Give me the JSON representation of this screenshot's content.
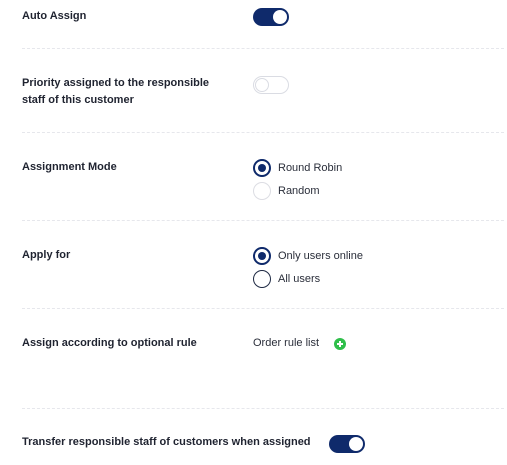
{
  "settings": {
    "auto_assign": {
      "label": "Auto Assign",
      "enabled": true
    },
    "priority_responsible": {
      "label_line1": "Priority assigned to the responsible",
      "label_line2": "staff of this customer",
      "enabled": false
    },
    "assignment_mode": {
      "label": "Assignment Mode",
      "options": [
        "Round Robin",
        "Random"
      ],
      "selected": "Round Robin"
    },
    "apply_for": {
      "label": "Apply for",
      "options": [
        "Only users online",
        "All users"
      ],
      "selected": "Only users online"
    },
    "optional_rule": {
      "label": "Assign according to optional rule",
      "link_text": "Order rule list"
    },
    "transfer_responsible": {
      "label": "Transfer responsible staff of customers when assigned",
      "enabled": true
    }
  },
  "colors": {
    "toggle_on": "#0f2a6b",
    "toggle_off_border": "#dadce3",
    "radio_checked": "#0f2a6b",
    "add_icon": "#2fbf4a",
    "divider": "#e6e7ec"
  },
  "icons": {
    "add": "plus-circle-icon"
  }
}
